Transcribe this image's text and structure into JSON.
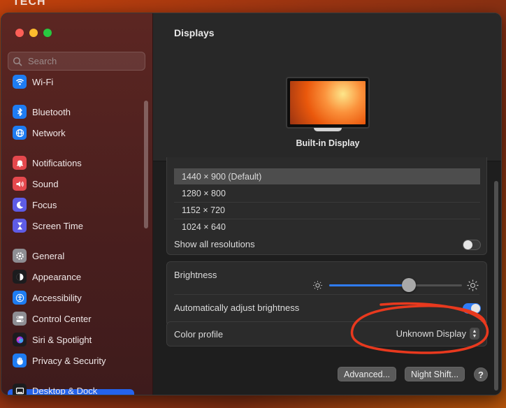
{
  "desktop": {
    "label": "TECH"
  },
  "window": {
    "title": "Displays"
  },
  "sidebar": {
    "search_placeholder": "Search",
    "items": [
      {
        "label": "Wi-Fi",
        "icon": "wifi-icon",
        "color": "#1e7cf2"
      },
      {
        "label": "Bluetooth",
        "icon": "bluetooth-icon",
        "color": "#1e7cf2"
      },
      {
        "label": "Network",
        "icon": "globe-icon",
        "color": "#1e7cf2"
      },
      {
        "label": "Notifications",
        "icon": "bell-icon",
        "color": "#e5484d"
      },
      {
        "label": "Sound",
        "icon": "speaker-icon",
        "color": "#e5484d"
      },
      {
        "label": "Focus",
        "icon": "moon-icon",
        "color": "#5e5ce6"
      },
      {
        "label": "Screen Time",
        "icon": "hourglass-icon",
        "color": "#5e5ce6"
      },
      {
        "label": "General",
        "icon": "gear-icon",
        "color": "#8e8e93"
      },
      {
        "label": "Appearance",
        "icon": "appearance-icon",
        "color": "#1c1c1e"
      },
      {
        "label": "Accessibility",
        "icon": "accessibility-icon",
        "color": "#1e7cf2"
      },
      {
        "label": "Control Center",
        "icon": "control-center-icon",
        "color": "#8e8e93"
      },
      {
        "label": "Siri & Spotlight",
        "icon": "siri-icon",
        "color": "#1c1c1e"
      },
      {
        "label": "Privacy & Security",
        "icon": "hand-icon",
        "color": "#1e7cf2"
      },
      {
        "label": "Desktop & Dock",
        "icon": "dock-icon",
        "color": "#1c1c1e"
      }
    ]
  },
  "display": {
    "name": "Built-in Display",
    "resolutions": [
      "1440 × 900 (Default)",
      "1280 × 800",
      "1152 × 720",
      "1024 × 640"
    ],
    "selected_resolution_index": 0,
    "show_all_label": "Show all resolutions",
    "show_all_on": false,
    "brightness_label": "Brightness",
    "brightness_level": 0.6,
    "auto_brightness_label": "Automatically adjust brightness",
    "auto_brightness_on": true,
    "color_profile_label": "Color profile",
    "color_profile_value": "Unknown Display",
    "advanced_label": "Advanced...",
    "night_shift_label": "Night Shift...",
    "help_label": "?"
  },
  "colors": {
    "accent": "#2f7cf6",
    "annotation": "#e8391e"
  }
}
